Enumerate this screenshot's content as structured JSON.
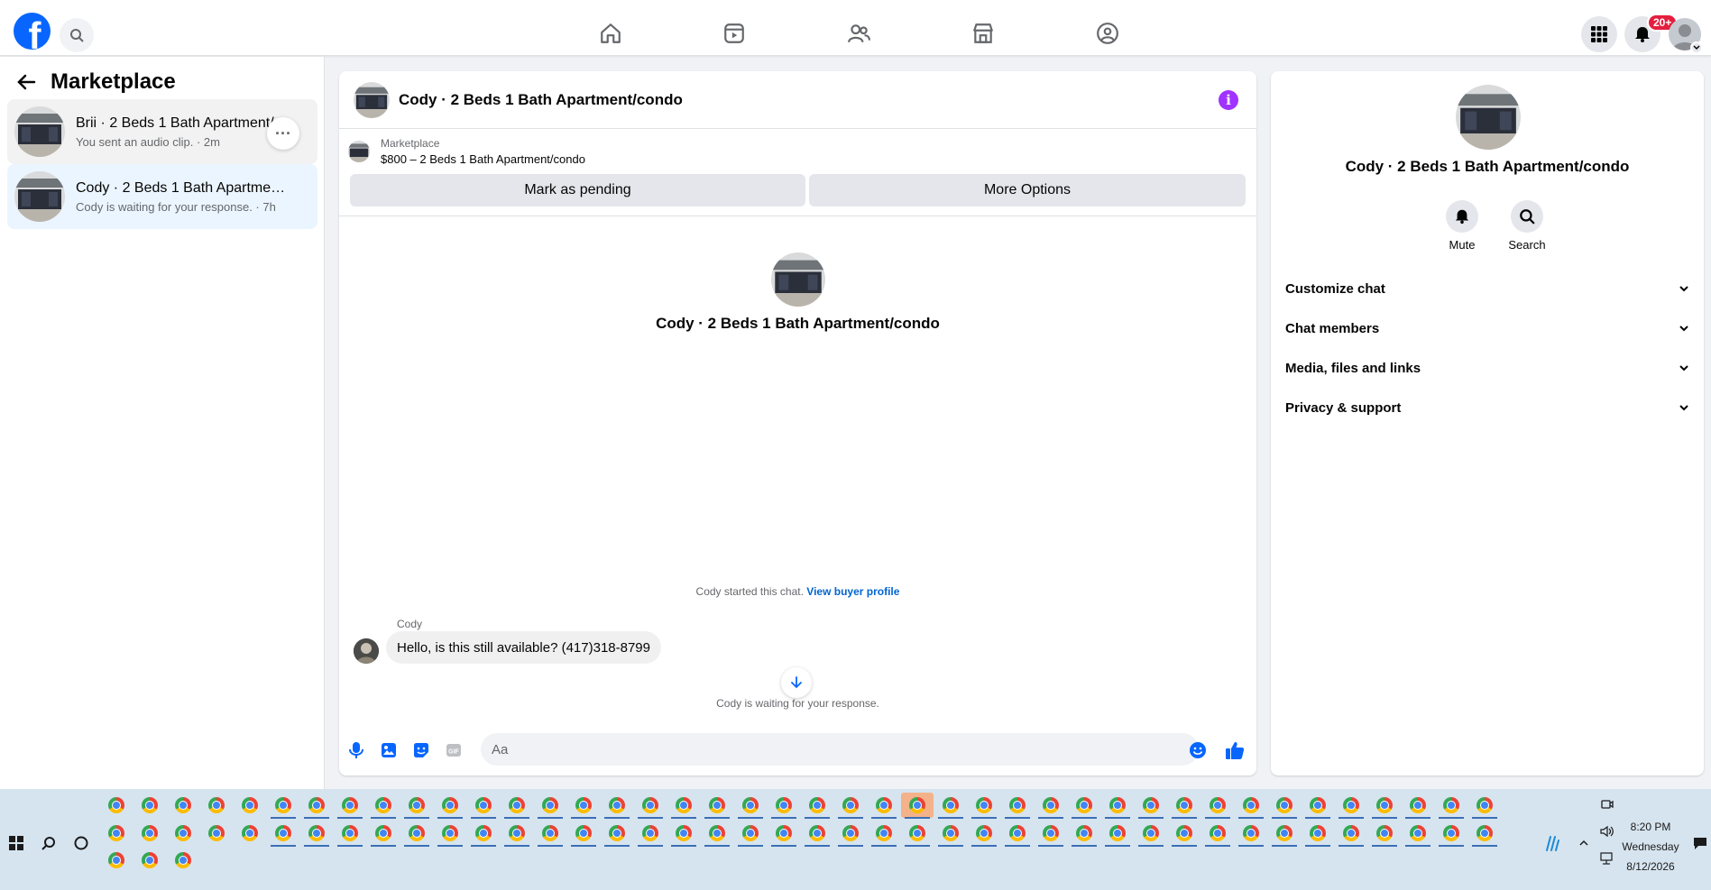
{
  "nav": {
    "logo": "f",
    "notification_badge": "20+",
    "icons": [
      "home-icon",
      "video-icon",
      "friends-icon",
      "marketplace-icon",
      "groups-icon"
    ]
  },
  "left": {
    "title": "Marketplace",
    "conversations": [
      {
        "name": "Brii · 2 Beds 1 Bath Apartment/...",
        "subtitle": "You sent an audio clip. · 2m"
      },
      {
        "name": "Cody · 2 Beds 1 Bath Apartment/c...",
        "subtitle": "Cody is waiting for your response. · 7h"
      }
    ],
    "more_label": "···"
  },
  "chat": {
    "title": "Cody · 2 Beds 1 Bath Apartment/condo",
    "info_label": "i",
    "listing_label": "Marketplace",
    "listing_price": "$800 – 2 Beds 1 Bath Apartment/condo",
    "mark_pending": "Mark as pending",
    "more_options": "More Options",
    "center_name": "Cody · 2 Beds 1 Bath Apartment/condo",
    "started_text": "Cody started this chat. ",
    "view_profile": "View buyer profile",
    "sender": "Cody",
    "message": "Hello, is this still available? (417)318-8799",
    "waiting": "Cody is waiting for your response.",
    "input_placeholder": "Aa"
  },
  "right": {
    "name": "Cody · 2 Beds 1 Bath Apartment/condo",
    "actions": [
      "Mute",
      "Search"
    ],
    "sections": [
      "Customize chat",
      "Chat members",
      "Media, files and links",
      "Privacy & support"
    ]
  },
  "taskbar": {
    "time": "8:20 PM",
    "day": "Wednesday",
    "date": "8/12/2026"
  },
  "colors": {
    "brand": "#0866ff",
    "accent_purple": "#a033ff",
    "link": "#0064d1",
    "badge_red": "#e41e3f"
  }
}
